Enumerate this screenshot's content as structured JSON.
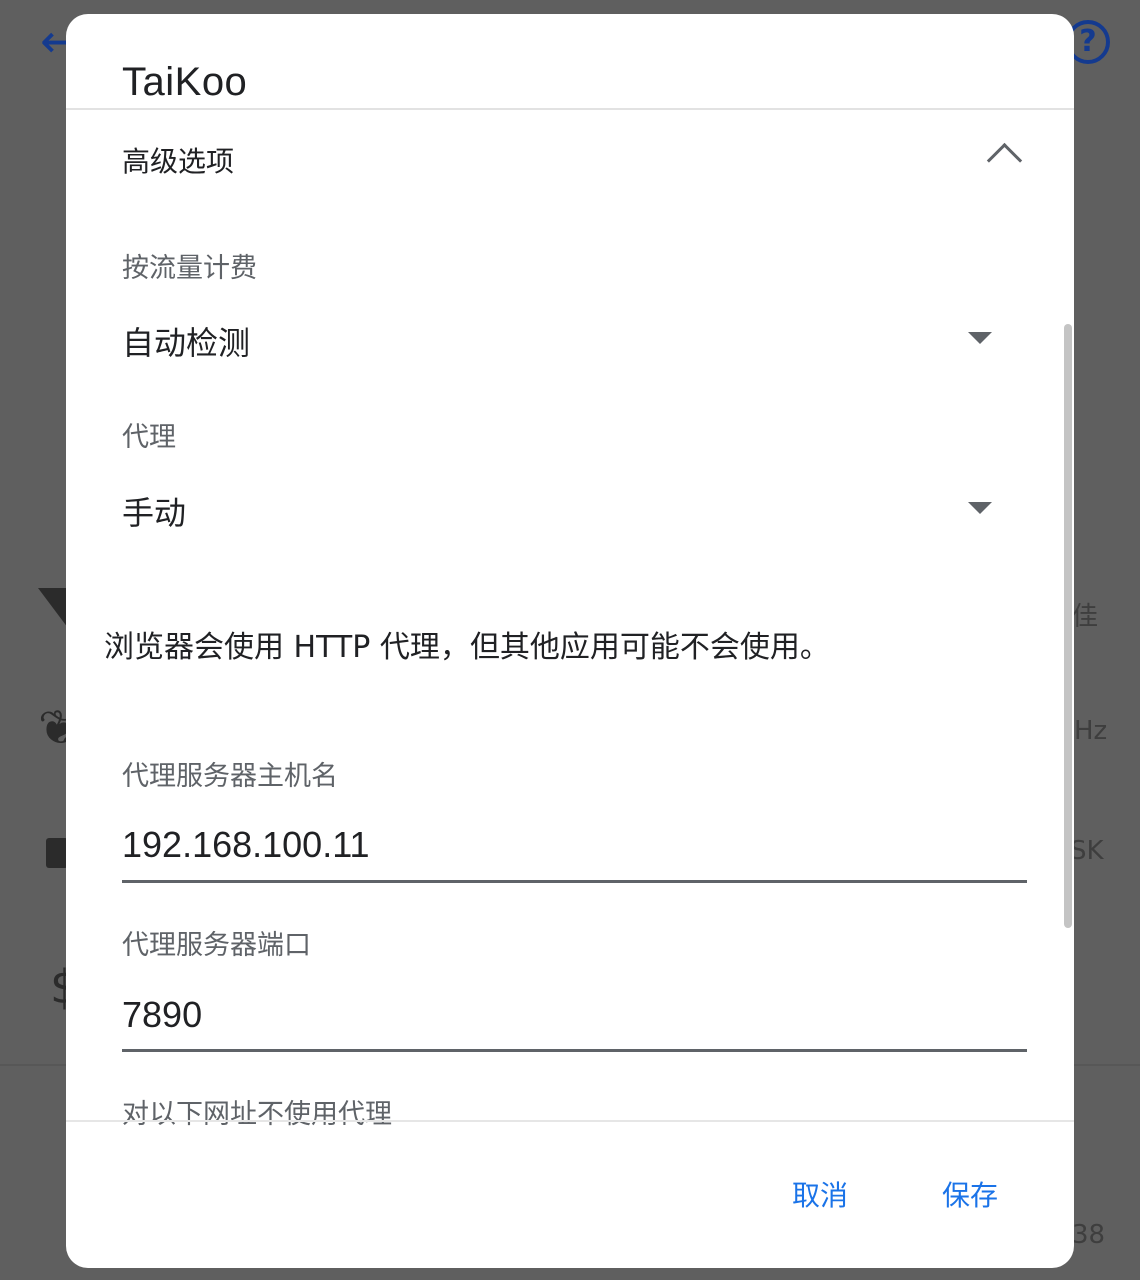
{
  "dialog": {
    "title": "TaiKoo",
    "advanced_header": "高级选项",
    "metered": {
      "label": "按流量计费",
      "value": "自动检测"
    },
    "proxy": {
      "label": "代理",
      "value": "手动"
    },
    "proxy_note": "浏览器会使用 HTTP 代理，但其他应用可能不会使用。",
    "hostname": {
      "label": "代理服务器主机名",
      "value": "192.168.100.11"
    },
    "port": {
      "label": "代理服务器端口",
      "value": "7890"
    },
    "bypass_label": "对以下网址不使用代理",
    "cancel_label": "取消",
    "save_label": "保存"
  },
  "background": {
    "fragments": [
      "佳",
      "Hz",
      "SK",
      "38"
    ]
  },
  "colors": {
    "accent": "#1a73e8",
    "scrim": "#5f5f5f",
    "text_primary": "#202124",
    "text_secondary": "#5f6368"
  }
}
